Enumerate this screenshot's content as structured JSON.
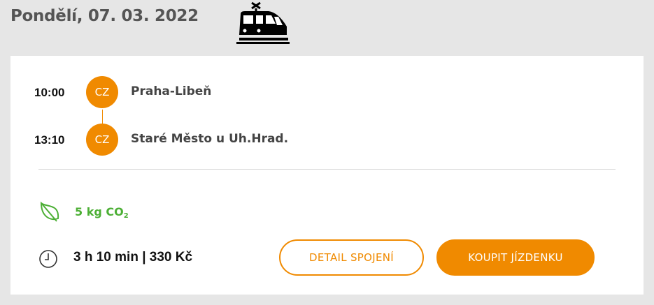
{
  "header": {
    "date": "Pondělí, 07. 03. 2022",
    "transport_icon": "train-icon"
  },
  "journey": {
    "stops": [
      {
        "time": "10:00",
        "country": "CZ",
        "station": "Praha-Libeň"
      },
      {
        "time": "13:10",
        "country": "CZ",
        "station": "Staré Město u Uh.Hrad."
      }
    ]
  },
  "emissions": {
    "icon": "leaf-icon",
    "amount": "5 kg CO",
    "subscript": "2"
  },
  "summary": {
    "icon": "clock-icon",
    "text": "3 h 10 min |  330 Kč"
  },
  "actions": {
    "detail_label": "DETAIL SPOJENÍ",
    "buy_label": "KOUPIT JÍZDENKU"
  },
  "colors": {
    "accent": "#f08a00",
    "eco": "#4caf35",
    "background": "#e6e6e6",
    "card": "#ffffff"
  }
}
